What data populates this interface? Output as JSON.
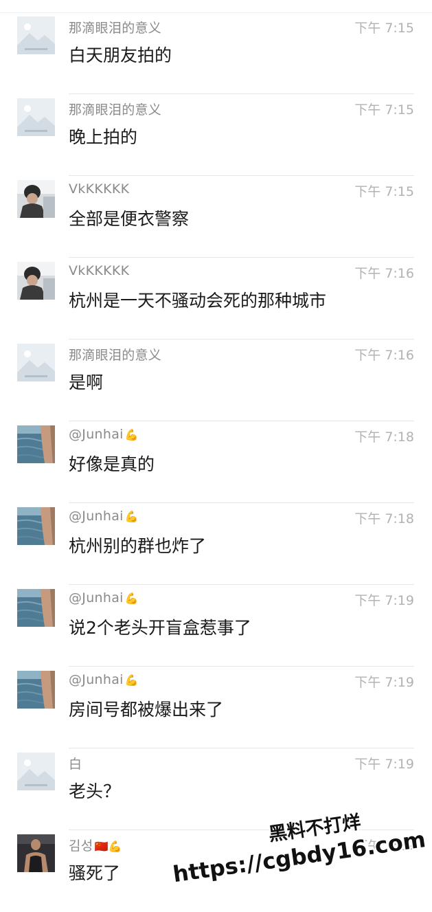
{
  "messages": [
    {
      "sender": "那滴眼泪的意义",
      "badge": "",
      "avatar": "placeholder-avatar",
      "time": "下午 7:15",
      "text": "白天朋友拍的"
    },
    {
      "sender": "那滴眼泪的意义",
      "badge": "",
      "avatar": "placeholder-avatar",
      "time": "下午 7:15",
      "text": "晚上拍的"
    },
    {
      "sender": "VkKKKKK",
      "badge": "",
      "avatar": "person-avatar",
      "time": "下午 7:15",
      "text": "全部是便衣警察"
    },
    {
      "sender": "VkKKKKK",
      "badge": "",
      "avatar": "person-avatar",
      "time": "下午 7:16",
      "text": "杭州是一天不骚动会死的那种城市"
    },
    {
      "sender": "那滴眼泪的意义",
      "badge": "",
      "avatar": "placeholder-avatar",
      "time": "下午 7:16",
      "text": "是啊"
    },
    {
      "sender": "@Junhai",
      "badge": "💪",
      "avatar": "sea-avatar",
      "time": "下午 7:18",
      "text": "好像是真的"
    },
    {
      "sender": "@Junhai",
      "badge": "💪",
      "avatar": "sea-avatar",
      "time": "下午 7:18",
      "text": "杭州别的群也炸了"
    },
    {
      "sender": "@Junhai",
      "badge": "💪",
      "avatar": "sea-avatar",
      "time": "下午 7:19",
      "text": "说2个老头开盲盒惹事了"
    },
    {
      "sender": "@Junhai",
      "badge": "💪",
      "avatar": "sea-avatar",
      "time": "下午 7:19",
      "text": "房间号都被爆出来了"
    },
    {
      "sender": "白",
      "badge": "",
      "avatar": "placeholder-avatar",
      "time": "下午 7:19",
      "text": "老头？"
    },
    {
      "sender": "김성",
      "badge": "🇨🇳💪",
      "avatar": "man-avatar",
      "time": "下午 7:19",
      "text": "骚死了"
    }
  ],
  "watermark": {
    "line1": "黑料不打烊",
    "line2": "https://cgbdy16.com"
  }
}
